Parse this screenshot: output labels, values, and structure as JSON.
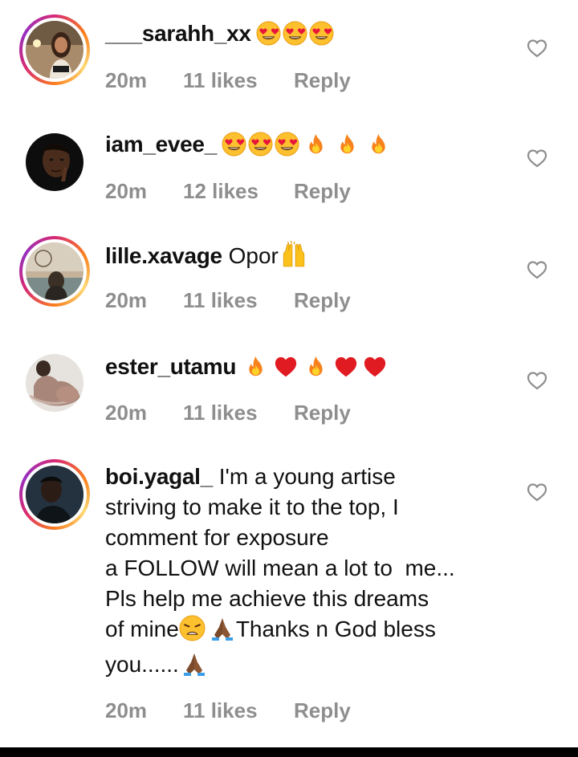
{
  "comments": [
    {
      "username": "___sarahh_xx",
      "text": "",
      "emojis": [
        "heart-eyes-emoji",
        "heart-eyes-emoji",
        "heart-eyes-emoji"
      ],
      "time": "20m",
      "likes": "11 likes",
      "reply": "Reply",
      "story_ring": true
    },
    {
      "username": "iam_evee_",
      "text": "",
      "emojis": [
        "heart-eyes-emoji",
        "heart-eyes-emoji",
        "heart-eyes-emoji",
        "fire-emoji",
        "fire-emoji",
        "fire-emoji"
      ],
      "time": "20m",
      "likes": "12 likes",
      "reply": "Reply",
      "story_ring": false
    },
    {
      "username": "lille.xavage",
      "text": "Opor",
      "emojis": [
        "raised-hands-emoji"
      ],
      "time": "20m",
      "likes": "11 likes",
      "reply": "Reply",
      "story_ring": true
    },
    {
      "username": "ester_utamu",
      "text": "",
      "emojis": [
        "fire-emoji",
        "red-heart-emoji",
        "fire-emoji",
        "red-heart-emoji",
        "red-heart-emoji"
      ],
      "time": "20m",
      "likes": "11 likes",
      "reply": "Reply",
      "story_ring": false
    },
    {
      "username": "boi.yagal_",
      "text_line1": "I'm a young artise",
      "text_line2": "striving to make it to the top, I",
      "text_line3": "comment for exposure",
      "text_line4": "a FOLLOW will mean a lot to  me...",
      "text_line5": "Pls help me achieve this dreams",
      "text_line6a": "of mine",
      "text_line6b": "Thanks n God bless",
      "text_line7": "you......",
      "emojis": [
        "weary-face-emoji",
        "folded-hands-emoji",
        "folded-hands-emoji"
      ],
      "time": "20m",
      "likes": "11 likes",
      "reply": "Reply",
      "story_ring": true
    }
  ],
  "colors": {
    "username": "#111111",
    "meta": "#8e8e8e",
    "heart_outline": "#8e8e8e",
    "story_ring_start": "#d62976",
    "story_ring_end": "#fa7e1e"
  },
  "icons": {
    "like": "heart-outline-icon"
  }
}
